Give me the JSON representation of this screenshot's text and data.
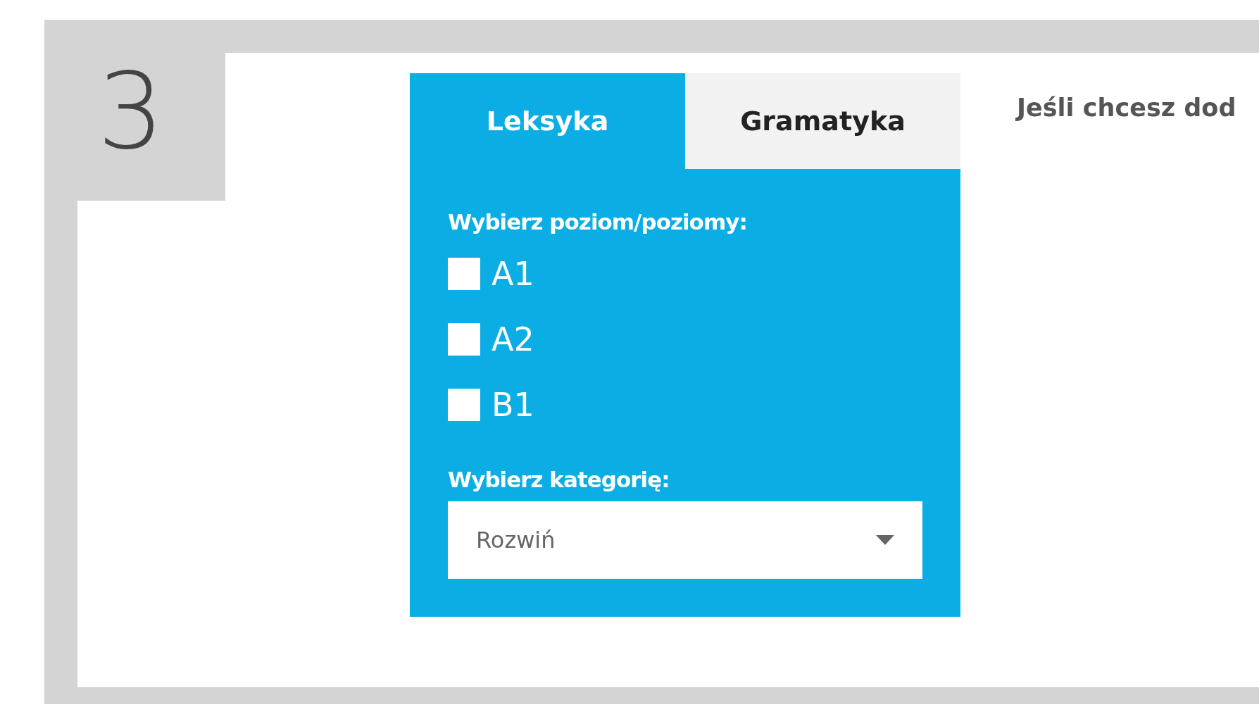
{
  "step_number": "3",
  "tabs": [
    {
      "label": "Leksyka",
      "selected": true
    },
    {
      "label": "Gramatyka",
      "selected": false
    }
  ],
  "levels_label": "Wybierz poziom/poziomy:",
  "levels": [
    {
      "label": "A1",
      "checked": false
    },
    {
      "label": "A2",
      "checked": false
    },
    {
      "label": "B1",
      "checked": false
    }
  ],
  "category_label": "Wybierz kategorię:",
  "category_select": {
    "value": "Rozwiń"
  },
  "hint": "Jeśli chcesz dod"
}
